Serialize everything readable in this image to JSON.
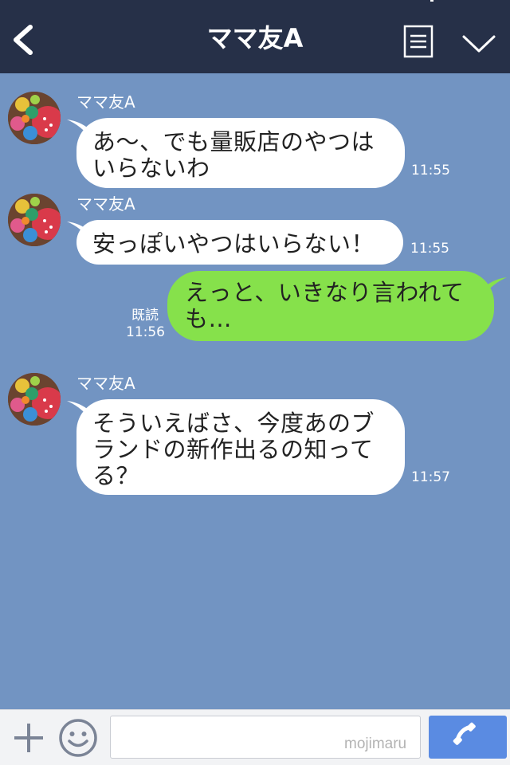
{
  "header": {
    "title": "ママ友A",
    "back_icon": "chevron-left-icon",
    "menu_icon": "list-icon",
    "collapse_icon": "chevron-down-icon",
    "background": "#263048"
  },
  "chat": {
    "background": "#7294c2",
    "messages": [
      {
        "direction": "incoming",
        "sender": "ママ友A",
        "lines": [
          "あ〜、でも量販店のやつは",
          "いらないわ"
        ],
        "time": "11:55"
      },
      {
        "direction": "incoming",
        "sender": "ママ友A",
        "lines": [
          "安っぽいやつはいらない！"
        ],
        "time": "11:55"
      },
      {
        "direction": "outgoing",
        "lines": [
          "えっと、いきなり言われて",
          "も…"
        ],
        "read": "既読",
        "time": "11:56"
      },
      {
        "direction": "incoming",
        "sender": "ママ友A",
        "lines": [
          "そういえばさ、今度あのブ",
          "ランドの新作出るの知って",
          "る？"
        ],
        "time": "11:57"
      }
    ]
  },
  "input_bar": {
    "plus_icon": "plus-icon",
    "emoji_icon": "smiley-icon",
    "placeholder": "",
    "watermark": "mojimaru",
    "call_icon": "phone-icon",
    "call_color": "#5a8be2"
  },
  "colors": {
    "incoming_bubble": "#ffffff",
    "outgoing_bubble": "#86e14b"
  }
}
